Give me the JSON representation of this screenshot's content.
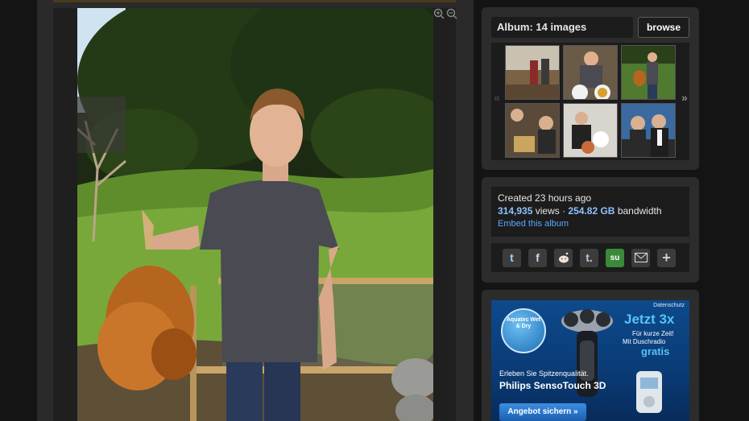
{
  "album": {
    "title": "Album: 14 images",
    "browse_label": "browse",
    "prev_arrow": "«",
    "next_arrow": "»"
  },
  "stats": {
    "created": "Created 23 hours ago",
    "views": "314,935",
    "views_label": "views ·",
    "bandwidth": "254.82 GB",
    "bandwidth_label": "bandwidth",
    "embed_label": "Embed this album"
  },
  "share": {
    "icons": [
      "twitter-icon",
      "facebook-icon",
      "reddit-icon",
      "tumblr-icon",
      "stumbleupon-icon",
      "email-icon",
      "plus-icon"
    ],
    "glyphs": [
      "t",
      "f",
      "●",
      "t.",
      "su",
      "✉",
      "+"
    ]
  },
  "ad": {
    "label": "Datenschutz",
    "badge": "Aquatec Wet & Dry",
    "headline": "Jetzt 3x",
    "sub1": "Für kurze Zeit!",
    "sub2": "Mit Duschradio",
    "gratis": "gratis",
    "line1": "Erleben Sie Spitzenqualität.",
    "line2": "Philips SensoTouch 3D",
    "cta": "Angebot sichern »"
  },
  "colors": {
    "accent_link": "#5aa7ff",
    "stat_value": "#8ec3ff",
    "background": "#141414",
    "panel": "#2c2c2c"
  }
}
